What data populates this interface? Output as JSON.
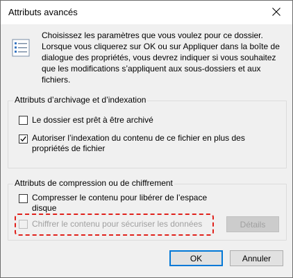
{
  "window": {
    "title": "Attributs avancés",
    "close_glyph": "✕"
  },
  "intro": {
    "icon": "properties-list-icon",
    "text": "Choisissez les paramètres que vous voulez pour ce dossier. Lorsque vous cliquerez sur OK ou sur Appliquer dans la boîte de dialogue des propriétés, vous devrez indiquer si vous souhaitez que les modifications s’appliquent aux sous-dossiers et aux fichiers."
  },
  "archive_group": {
    "label": "Attributs d’archivage et d’indexation",
    "archive_checkbox": {
      "label": "Le dossier est prêt à être archivé",
      "checked": false
    },
    "index_checkbox": {
      "label": "Autoriser l’indexation du contenu de ce fichier en plus des propriétés de fichier",
      "checked": true
    }
  },
  "compress_group": {
    "label": "Attributs de compression ou de chiffrement",
    "compress_checkbox": {
      "label": "Compresser le contenu pour libérer de l’espace disque",
      "checked": false
    },
    "encrypt_checkbox": {
      "label": "Chiffrer le contenu pour sécuriser les données",
      "checked": false,
      "enabled": false
    },
    "details_button": "Détails"
  },
  "buttons": {
    "ok": "OK",
    "cancel": "Annuler"
  },
  "colors": {
    "highlight": "#e0201a",
    "accent": "#0078d7",
    "dialog_bg": "#f0f0f0"
  }
}
